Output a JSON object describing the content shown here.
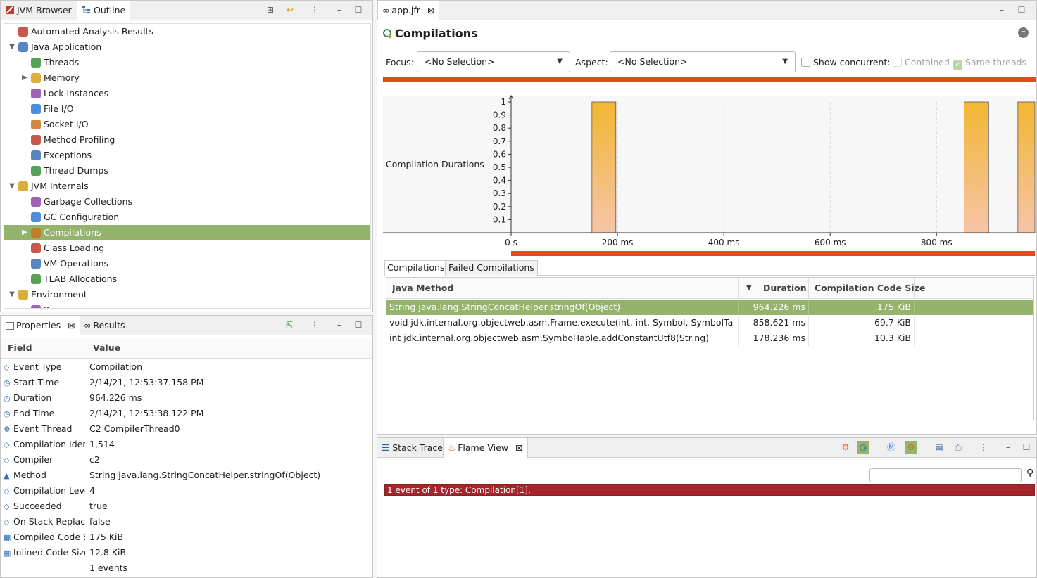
{
  "left_top": {
    "tabs": [
      "JVM Browser",
      "Outline"
    ],
    "tree": [
      {
        "label": "Automated Analysis Results",
        "indent": 0,
        "twist": "",
        "icon": "analysis-icon"
      },
      {
        "label": "Java Application",
        "indent": 0,
        "twist": "down",
        "icon": "java-app-icon"
      },
      {
        "label": "Threads",
        "indent": 1,
        "twist": "",
        "icon": "threads-icon"
      },
      {
        "label": "Memory",
        "indent": 1,
        "twist": "right",
        "icon": "memory-icon"
      },
      {
        "label": "Lock Instances",
        "indent": 1,
        "twist": "",
        "icon": "lock-icon"
      },
      {
        "label": "File I/O",
        "indent": 1,
        "twist": "",
        "icon": "file-io-icon"
      },
      {
        "label": "Socket I/O",
        "indent": 1,
        "twist": "",
        "icon": "socket-io-icon"
      },
      {
        "label": "Method Profiling",
        "indent": 1,
        "twist": "",
        "icon": "method-profiling-icon"
      },
      {
        "label": "Exceptions",
        "indent": 1,
        "twist": "",
        "icon": "exceptions-icon"
      },
      {
        "label": "Thread Dumps",
        "indent": 1,
        "twist": "",
        "icon": "thread-dumps-icon"
      },
      {
        "label": "JVM Internals",
        "indent": 0,
        "twist": "down",
        "icon": "jvm-internals-icon"
      },
      {
        "label": "Garbage Collections",
        "indent": 1,
        "twist": "",
        "icon": "trash-icon"
      },
      {
        "label": "GC Configuration",
        "indent": 1,
        "twist": "",
        "icon": "gc-config-icon"
      },
      {
        "label": "Compilations",
        "indent": 1,
        "twist": "right",
        "icon": "compilations-icon",
        "selected": true
      },
      {
        "label": "Class Loading",
        "indent": 1,
        "twist": "",
        "icon": "class-loading-icon"
      },
      {
        "label": "VM Operations",
        "indent": 1,
        "twist": "",
        "icon": "vm-operations-icon"
      },
      {
        "label": "TLAB Allocations",
        "indent": 1,
        "twist": "",
        "icon": "tlab-icon"
      },
      {
        "label": "Environment",
        "indent": 0,
        "twist": "down",
        "icon": "environment-icon"
      },
      {
        "label": "Processes",
        "indent": 1,
        "twist": "",
        "icon": "processes-icon"
      }
    ]
  },
  "properties": {
    "tabs": [
      "Properties",
      "Results"
    ],
    "col_field": "Field",
    "col_value": "Value",
    "rows": [
      {
        "field": "Event Type",
        "value": "Compilation",
        "icon": "event-type-icon"
      },
      {
        "field": "Start Time",
        "value": "2/14/21, 12:53:37.158 PM",
        "icon": "clock-icon"
      },
      {
        "field": "Duration",
        "value": "964.226 ms",
        "icon": "timer-icon"
      },
      {
        "field": "End Time",
        "value": "2/14/21, 12:53:38.122 PM",
        "icon": "clock-icon"
      },
      {
        "field": "Event Thread",
        "value": "C2 CompilerThread0",
        "icon": "thread-icon"
      },
      {
        "field": "Compilation Identifier",
        "value": "1,514",
        "icon": "id-icon"
      },
      {
        "field": "Compiler",
        "value": "c2",
        "icon": "compiler-icon"
      },
      {
        "field": "Method",
        "value": "String java.lang.StringConcatHelper.stringOf(Object)",
        "icon": "method-icon"
      },
      {
        "field": "Compilation Level",
        "value": "4",
        "icon": "level-icon"
      },
      {
        "field": "Succeeded",
        "value": "true",
        "icon": "succeeded-icon"
      },
      {
        "field": "On Stack Replacement",
        "value": "false",
        "icon": "osr-icon"
      },
      {
        "field": "Compiled Code Size",
        "value": "175 KiB",
        "icon": "binary-icon"
      },
      {
        "field": "Inlined Code Size",
        "value": "12.8 KiB",
        "icon": "binary-icon"
      },
      {
        "field": "",
        "value": "1 events",
        "icon": ""
      }
    ]
  },
  "editor": {
    "tab": "app.jfr",
    "title": "Compilations",
    "focus_label": "Focus:",
    "focus_value": "<No Selection>",
    "aspect_label": "Aspect:",
    "aspect_value": "<No Selection>",
    "show_concurrent": "Show concurrent:",
    "contained": "Contained",
    "same_threads": "Same threads",
    "chart_row_label": "Compilation Durations",
    "subtabs": [
      "Compilations",
      "Failed Compilations"
    ],
    "table": {
      "headers": [
        "Java Method",
        "Duration",
        "Compilation Code Size"
      ],
      "rows": [
        {
          "method": "String java.lang.StringConcatHelper.stringOf(Object)",
          "duration": "964.226 ms",
          "size": "175 KiB",
          "selected": true
        },
        {
          "method": "void jdk.internal.org.objectweb.asm.Frame.execute(int, int, Symbol, SymbolTable)",
          "duration": "858.621 ms",
          "size": "69.7 KiB"
        },
        {
          "method": "int jdk.internal.org.objectweb.asm.SymbolTable.addConstantUtf8(String)",
          "duration": "178.236 ms",
          "size": "10.3 KiB"
        }
      ]
    }
  },
  "chart_data": {
    "type": "bar",
    "title": "",
    "ylabel": "Compilation Durations",
    "xlabel": "",
    "ylim": [
      0,
      1
    ],
    "yticks": [
      "0.1",
      "0.2",
      "0.3",
      "0.4",
      "0.5",
      "0.6",
      "0.7",
      "0.8",
      "0.9",
      "1"
    ],
    "xticks": [
      "0 s",
      "200 ms",
      "400 ms",
      "600 ms",
      "800 ms"
    ],
    "xtick_values": [
      0,
      200,
      400,
      600,
      800
    ],
    "xlim": [
      0,
      985
    ],
    "bars": [
      {
        "start": 152,
        "end": 197,
        "value": 1
      },
      {
        "start": 852,
        "end": 898,
        "value": 1
      },
      {
        "start": 953,
        "end": 985,
        "value": 1
      }
    ]
  },
  "bottom": {
    "tabs": [
      "Stack Trace",
      "Flame View"
    ],
    "flame_text": "1 event of 1 type: Compilation[1],",
    "search_placeholder": ""
  },
  "colors": {
    "selection": "#94b46e",
    "bar_top": "#f2b731",
    "bar_bottom": "#f6c4a8",
    "timeline": "#e8491c",
    "flame": "#a4262c"
  }
}
